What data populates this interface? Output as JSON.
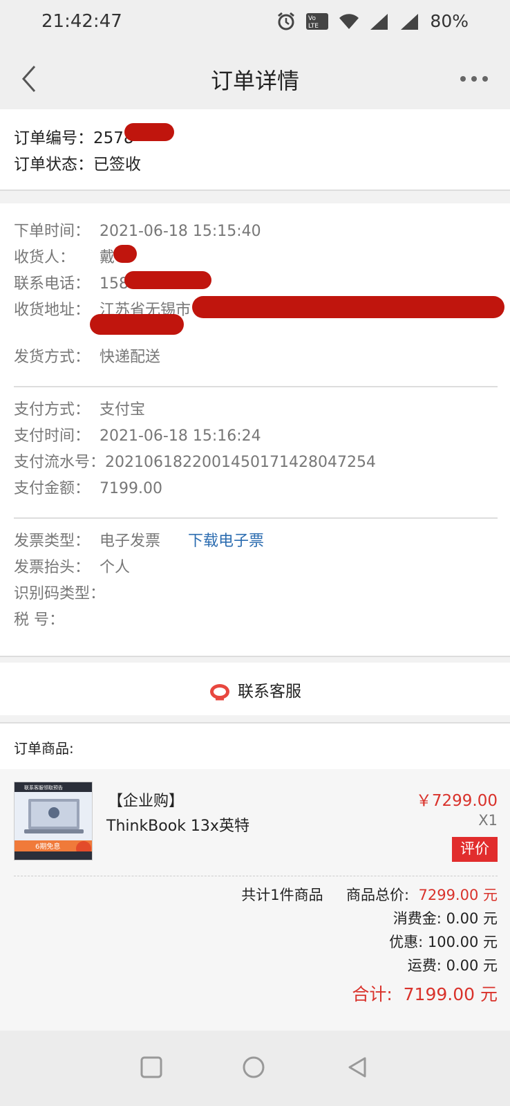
{
  "status_bar": {
    "time": "21:42:47",
    "battery": "80%"
  },
  "nav": {
    "title": "订单详情"
  },
  "order": {
    "number_label": "订单编号：",
    "number_value": "2578",
    "status_label": "订单状态：",
    "status_value": "已签收"
  },
  "details": {
    "order_time_label": "下单时间：",
    "order_time": "2021-06-18 15:15:40",
    "receiver_label": "收货人：",
    "receiver": "戴",
    "phone_label": "联系电话：",
    "phone": "158",
    "address_label": "收货地址：",
    "address": "江苏省无锡市",
    "shipping_label": "发货方式：",
    "shipping": "快递配送"
  },
  "payment": {
    "method_label": "支付方式：",
    "method": "支付宝",
    "time_label": "支付时间：",
    "time": "2021-06-18 15:16:24",
    "serial_label": "支付流水号：",
    "serial": "2021061822001450171428047254",
    "amount_label": "支付金额：",
    "amount": "7199.00"
  },
  "invoice": {
    "type_label": "发票类型：",
    "type": "电子发票",
    "download_link": "下载电子票",
    "title_label": "发票抬头：",
    "title": "个人",
    "idcode_label": "识别码类型：",
    "tax_label": "税 号："
  },
  "service": {
    "label": "联系客服"
  },
  "goods": {
    "header": "订单商品:",
    "thumb_top_text": "联系客服领取预告",
    "thumb_badge": "6期免息",
    "name_line1": "【企业购】",
    "name_line2": "ThinkBook 13x英特",
    "price": "￥7299.00",
    "qty": "X1",
    "review_button": "评价"
  },
  "summary": {
    "count_text": "共计1件商品",
    "goods_total_label": "商品总价:",
    "goods_total_value": "7299.00 元",
    "consume_label": "消费金:",
    "consume_value": "0.00 元",
    "discount_label": "优惠:",
    "discount_value": "100.00 元",
    "freight_label": "运费:",
    "freight_value": "0.00 元",
    "total_label": "合计:",
    "total_value": "7199.00 元"
  },
  "colors": {
    "accent_red": "#d9322b",
    "link_blue": "#2b6cb0",
    "redaction": "#c0150d"
  },
  "icons": [
    "alarm-icon",
    "volte-icon",
    "wifi-icon",
    "signal-4g-icon",
    "signal-g-icon",
    "back-icon",
    "more-icon",
    "headset-icon",
    "square-nav-icon",
    "circle-nav-icon",
    "triangle-nav-icon"
  ]
}
